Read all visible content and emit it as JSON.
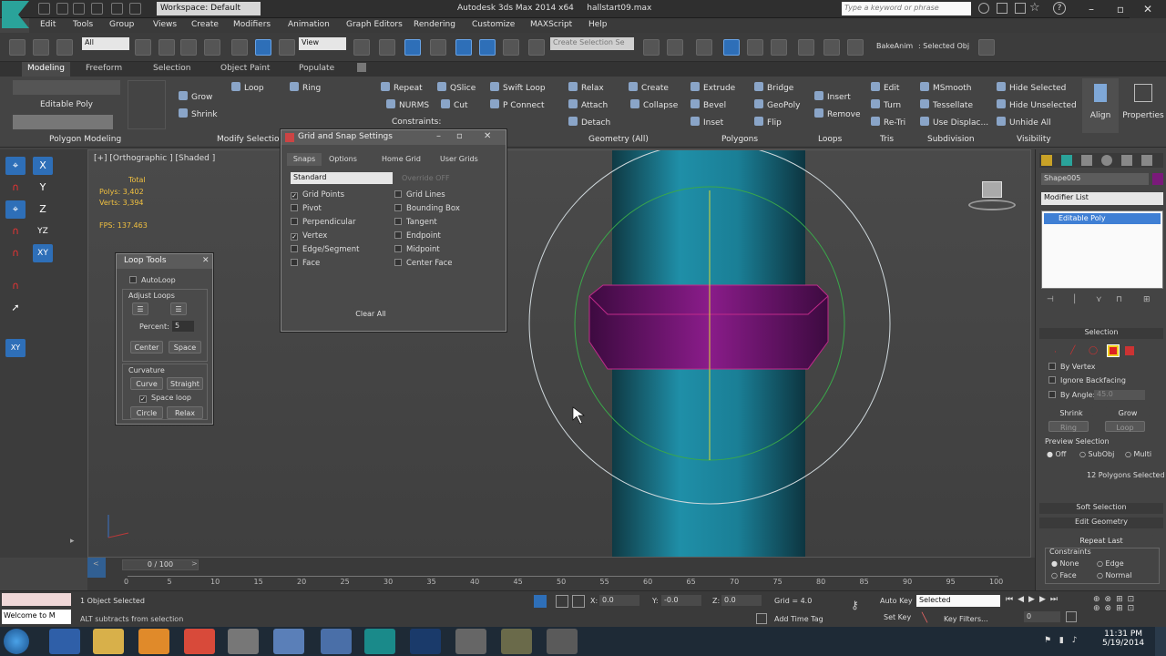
{
  "title_bar": {
    "workspace": "Workspace: Default",
    "window_title": "Autodesk 3ds Max 2014 x64",
    "file_name": "hallstart09.max",
    "search_placeholder": "Type a keyword or phrase"
  },
  "menu": [
    "Edit",
    "Tools",
    "Group",
    "Views",
    "Create",
    "Modifiers",
    "Animation",
    "Graph Editors",
    "Rendering",
    "Customize",
    "MAXScript",
    "Help"
  ],
  "main_toolbar": {
    "selection_filter": "All",
    "ref_coord": "View",
    "named_selection": "Create Selection Se",
    "bake_label": "BakeAnim",
    "selected_obj_label": ": Selected Obj"
  },
  "ribbon": {
    "tabs": [
      "Modeling",
      "Freeform",
      "Selection",
      "Object Paint",
      "Populate"
    ],
    "object_type": "Editable Poly",
    "buttons": {
      "grow": "Grow",
      "shrink": "Shrink",
      "loop": "Loop",
      "ring": "Ring",
      "repeat": "Repeat",
      "qslice": "QSlice",
      "swift_loop": "Swift Loop",
      "nurms": "NURMS",
      "cut": "Cut",
      "p_connect": "P Connect",
      "constraints": "Constraints:",
      "relax": "Relax",
      "create": "Create",
      "attach": "Attach",
      "collapse": "Collapse",
      "detach": "Detach",
      "extrude": "Extrude",
      "bridge": "Bridge",
      "bevel": "Bevel",
      "geopoly": "GeoPoly",
      "inset": "Inset",
      "flip": "Flip",
      "insert": "Insert",
      "remove": "Remove",
      "edit": "Edit",
      "turn": "Turn",
      "retri": "Re-Tri",
      "msmooth": "MSmooth",
      "tessellate": "Tessellate",
      "use_displac": "Use Displac...",
      "hide_selected": "Hide Selected",
      "hide_unselected": "Hide Unselected",
      "unhide_all": "Unhide All",
      "align": "Align",
      "properties": "Properties"
    },
    "groups": [
      "Polygon Modeling",
      "Modify Selection",
      "Geometry (All)",
      "Polygons",
      "Loops",
      "Tris",
      "Subdivision",
      "Visibility"
    ]
  },
  "viewport": {
    "label": "[+] [Orthographic ] [Shaded ]",
    "stats": {
      "total": "Total",
      "polys": "Polys: 3,402",
      "verts": "Verts: 3,394",
      "fps": "FPS: 137.463"
    },
    "axis_buttons": [
      "X",
      "Y",
      "Z",
      "YZ",
      "XY"
    ]
  },
  "loop_tools": {
    "title": "Loop Tools",
    "autoloop": "AutoLoop",
    "adjust_loops": "Adjust Loops",
    "percent_label": "Percent:",
    "percent_value": "5",
    "center": "Center",
    "space": "Space",
    "curvature": "Curvature",
    "curve": "Curve",
    "straight": "Straight",
    "space_loop": "Space loop",
    "circle": "Circle",
    "relax": "Relax"
  },
  "snap_dialog": {
    "title": "Grid and Snap Settings",
    "tabs": [
      "Snaps",
      "Options",
      "Home Grid",
      "User Grids"
    ],
    "preset": "Standard",
    "override": "Override OFF",
    "left_items": [
      {
        "label": "Grid Points",
        "checked": "✓"
      },
      {
        "label": "Pivot",
        "checked": ""
      },
      {
        "label": "Perpendicular",
        "checked": ""
      },
      {
        "label": "Vertex",
        "checked": "✓"
      },
      {
        "label": "Edge/Segment",
        "checked": ""
      },
      {
        "label": "Face",
        "checked": ""
      }
    ],
    "right_items": [
      {
        "label": "Grid Lines",
        "checked": ""
      },
      {
        "label": "Bounding Box",
        "checked": ""
      },
      {
        "label": "Tangent",
        "checked": ""
      },
      {
        "label": "Endpoint",
        "checked": ""
      },
      {
        "label": "Midpoint",
        "checked": ""
      },
      {
        "label": "Center Face",
        "checked": ""
      }
    ],
    "clear_all": "Clear All"
  },
  "command_panel": {
    "object_name": "Shape005",
    "modifier_list": "Modifier List",
    "stack_item": "Editable Poly",
    "selection_header": "Selection",
    "by_vertex": "By Vertex",
    "ignore_backfacing": "Ignore Backfacing",
    "by_angle": "By Angle:",
    "by_angle_value": "45.0",
    "shrink": "Shrink",
    "grow": "Grow",
    "ring": "Ring",
    "loop": "Loop",
    "preview_selection": "Preview Selection",
    "preview_off": "Off",
    "preview_subobj": "SubObj",
    "preview_multi": "Multi",
    "selected_count": "12 Polygons Selected",
    "soft_selection": "Soft Selection",
    "edit_geometry": "Edit Geometry",
    "repeat_last": "Repeat Last",
    "constraints": "Constraints",
    "c_none": "None",
    "c_edge": "Edge",
    "c_face": "Face",
    "c_normal": "Normal"
  },
  "timeline": {
    "frame": "0 / 100",
    "ticks": [
      "0",
      "5",
      "10",
      "15",
      "20",
      "25",
      "30",
      "35",
      "40",
      "45",
      "50",
      "55",
      "60",
      "65",
      "70",
      "75",
      "80",
      "85",
      "90",
      "95",
      "100"
    ]
  },
  "status_bar": {
    "listener": "Welcome to M",
    "objects_selected": "1 Object Selected",
    "prompt": "ALT subtracts from selection",
    "x_label": "X:",
    "x_value": "0.0",
    "y_label": "Y:",
    "y_value": "-0.0",
    "z_label": "Z:",
    "z_value": "0.0",
    "grid": "Grid = 4.0",
    "add_time_tag": "Add Time Tag",
    "auto_key": "Auto Key",
    "set_key": "Set Key",
    "key_mode": "Selected",
    "key_filters": "Key Filters...",
    "current_frame": "0"
  },
  "taskbar": {
    "time": "11:31 PM",
    "date": "5/19/2014"
  },
  "colors": {
    "accent_blue": "#2e6fb8",
    "cylinder": "#1f8fa8",
    "selected_ring": "#7a1a7a"
  }
}
